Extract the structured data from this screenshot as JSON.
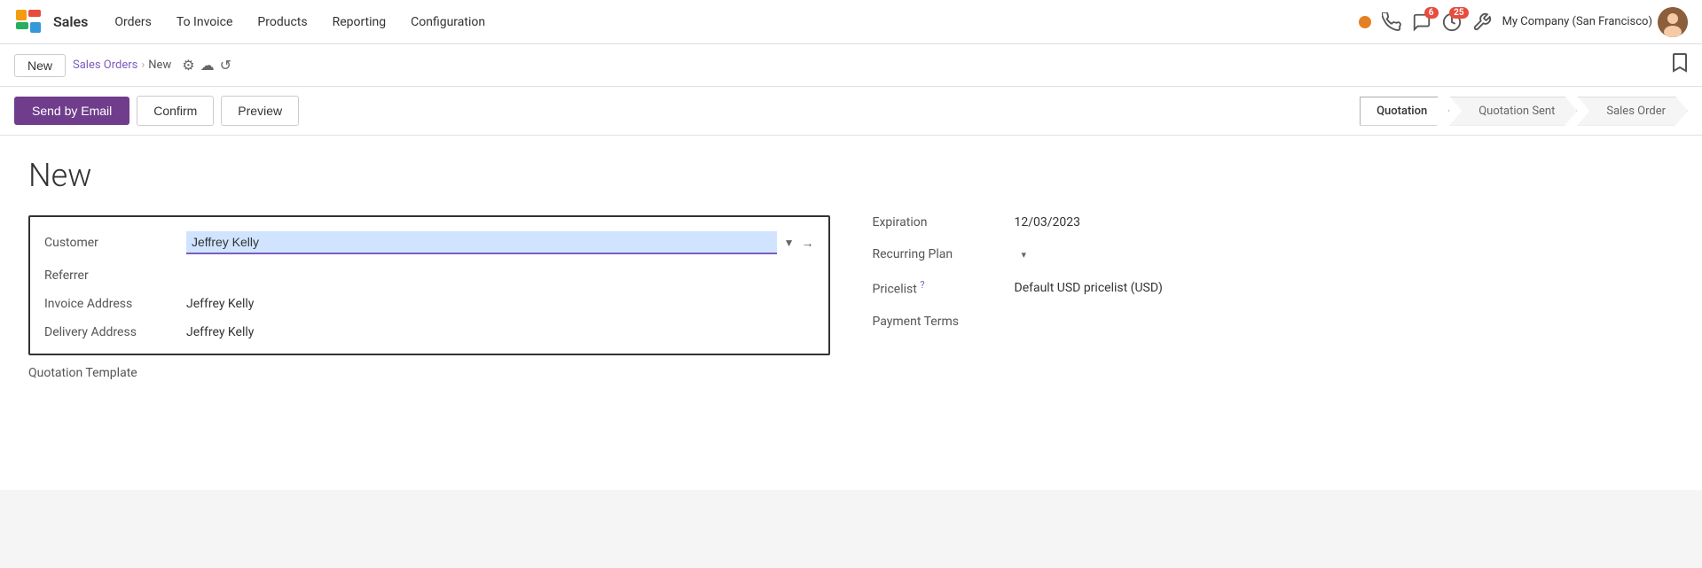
{
  "app": {
    "name": "Sales",
    "logo_color": "#f39c12"
  },
  "topnav": {
    "menu_items": [
      "Orders",
      "To Invoice",
      "Products",
      "Reporting",
      "Configuration"
    ],
    "company": "My Company (San Francisco)"
  },
  "actionbar": {
    "new_label": "New",
    "breadcrumb_parent": "Sales Orders",
    "breadcrumb_current": "New"
  },
  "buttons": {
    "send_by_email": "Send by Email",
    "confirm": "Confirm",
    "preview": "Preview"
  },
  "status": {
    "steps": [
      "Quotation",
      "Quotation Sent",
      "Sales Order"
    ],
    "active": "Quotation"
  },
  "form": {
    "title": "New",
    "left": {
      "customer_label": "Customer",
      "customer_value": "Jeffrey Kelly",
      "referrer_label": "Referrer",
      "referrer_value": "",
      "invoice_address_label": "Invoice Address",
      "invoice_address_value": "Jeffrey Kelly",
      "delivery_address_label": "Delivery Address",
      "delivery_address_value": "Jeffrey Kelly",
      "quotation_template_label": "Quotation Template"
    },
    "right": {
      "expiration_label": "Expiration",
      "expiration_value": "12/03/2023",
      "recurring_plan_label": "Recurring Plan",
      "recurring_plan_value": "",
      "pricelist_label": "Pricelist",
      "pricelist_help": "?",
      "pricelist_value": "Default USD pricelist (USD)",
      "payment_terms_label": "Payment Terms",
      "payment_terms_value": ""
    }
  },
  "icons": {
    "dot": "●",
    "phone": "📞",
    "chat": "💬",
    "clock": "🕐",
    "wrench": "🔧",
    "bookmark": "🔖",
    "gear": "⚙",
    "cloud": "☁",
    "undo": "↺",
    "arrow_right": "→",
    "dropdown": "▼",
    "chevron_down": "▾"
  },
  "badges": {
    "chat_count": "6",
    "clock_count": "25"
  }
}
